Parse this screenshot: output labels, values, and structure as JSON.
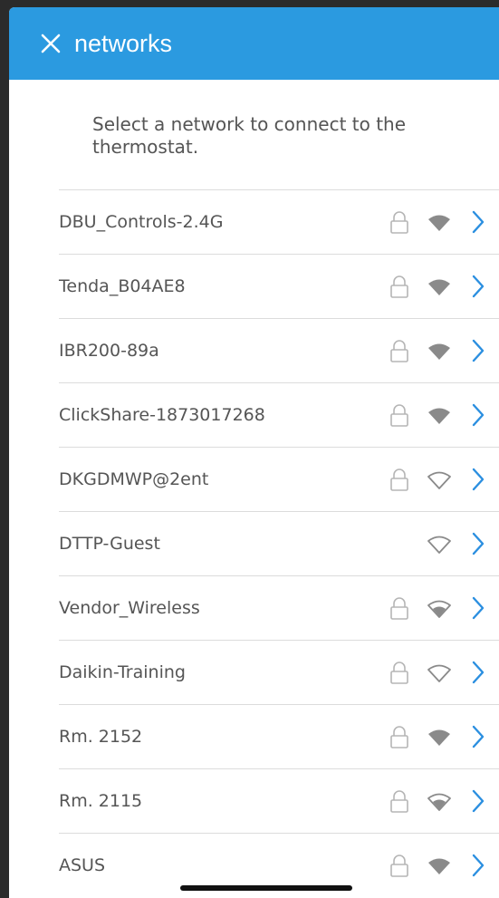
{
  "header": {
    "title": "networks",
    "close_icon": "close-icon",
    "background": "#2b9ae0"
  },
  "instruction": "Select a network to connect to the thermostat.",
  "networks": [
    {
      "name": "DBU_Controls-2.4G",
      "secured": true,
      "signal": "filled"
    },
    {
      "name": "Tenda_B04AE8",
      "secured": true,
      "signal": "filled"
    },
    {
      "name": "IBR200-89a",
      "secured": true,
      "signal": "filled"
    },
    {
      "name": "ClickShare-1873017268",
      "secured": true,
      "signal": "filled"
    },
    {
      "name": "DKGDMWP@2ent",
      "secured": true,
      "signal": "outline"
    },
    {
      "name": "DTTP-Guest",
      "secured": false,
      "signal": "outline"
    },
    {
      "name": "Vendor_Wireless",
      "secured": true,
      "signal": "partial"
    },
    {
      "name": "Daikin-Training",
      "secured": true,
      "signal": "outline"
    },
    {
      "name": "Rm. 2152",
      "secured": true,
      "signal": "filled"
    },
    {
      "name": "Rm. 2115",
      "secured": true,
      "signal": "partial"
    },
    {
      "name": "ASUS",
      "secured": true,
      "signal": "filled"
    }
  ],
  "icons": {
    "lock": "lock-icon",
    "wifi": "wifi-icon",
    "chevron": "chevron-right-icon"
  },
  "colors": {
    "accent": "#2b9ae0",
    "chevron": "#2b8fe0",
    "wifi": "#8a8a8a",
    "lock": "#b5b5b5"
  }
}
